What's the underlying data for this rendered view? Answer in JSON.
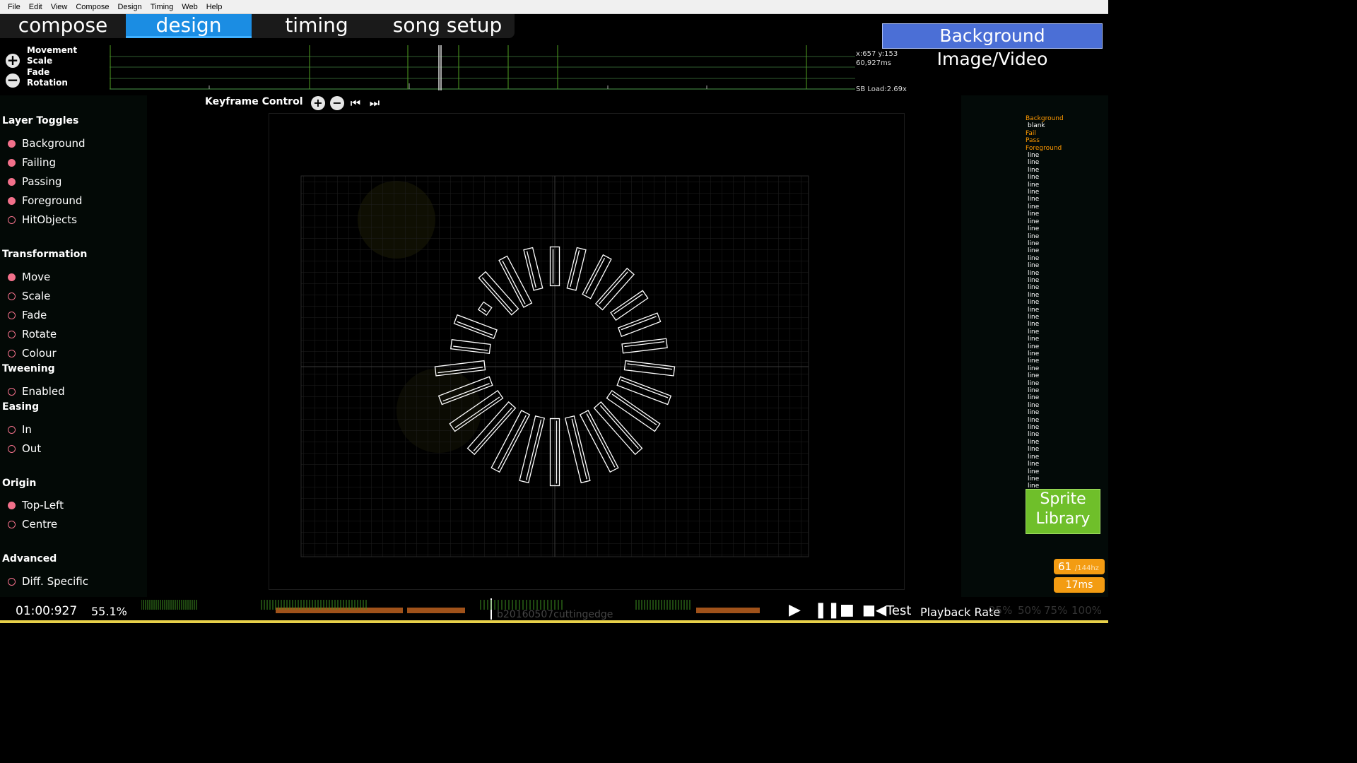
{
  "menubar": {
    "items": [
      "File",
      "Edit",
      "View",
      "Compose",
      "Design",
      "Timing",
      "Web",
      "Help"
    ]
  },
  "mode_tabs": [
    {
      "label": "compose",
      "active": false
    },
    {
      "label": "design",
      "active": true
    },
    {
      "label": "timing",
      "active": false
    },
    {
      "label": "song setup",
      "active": false
    }
  ],
  "background_button": "Background Image/Video",
  "timeline": {
    "labels": [
      "Movement",
      "Scale",
      "Fade",
      "Rotation"
    ],
    "coords": "x:657 y:153",
    "time_ms": "60,927ms",
    "sb_load": "SB Load:2.69x"
  },
  "keyframe_control": {
    "title": "Keyframe Control"
  },
  "sidebar": {
    "layer_toggles": {
      "title": "Layer Toggles",
      "items": [
        {
          "label": "Background",
          "on": true
        },
        {
          "label": "Failing",
          "on": true
        },
        {
          "label": "Passing",
          "on": true
        },
        {
          "label": "Foreground",
          "on": true
        },
        {
          "label": "HitObjects",
          "on": false
        }
      ]
    },
    "transformation": {
      "title": "Transformation",
      "items": [
        {
          "label": "Move",
          "on": true
        },
        {
          "label": "Scale",
          "on": false
        },
        {
          "label": "Fade",
          "on": false
        },
        {
          "label": "Rotate",
          "on": false
        },
        {
          "label": "Colour",
          "on": false
        }
      ]
    },
    "tweening": {
      "title": "Tweening",
      "items": [
        {
          "label": "Enabled",
          "on": false
        }
      ]
    },
    "easing": {
      "title": "Easing",
      "items": [
        {
          "label": "In",
          "on": false
        },
        {
          "label": "Out",
          "on": false
        }
      ]
    },
    "origin": {
      "title": "Origin",
      "items": [
        {
          "label": "Top-Left",
          "on": true
        },
        {
          "label": "Centre",
          "on": false
        }
      ]
    },
    "advanced": {
      "title": "Advanced",
      "items": [
        {
          "label": "Diff. Specific",
          "on": false
        }
      ]
    }
  },
  "layer_list": {
    "groups": [
      {
        "name": "Background",
        "items": [
          "blank"
        ]
      },
      {
        "name": "Fail",
        "items": []
      },
      {
        "name": "Pass",
        "items": []
      },
      {
        "name": "Foreground",
        "items": [
          "line",
          "line",
          "line",
          "line",
          "line",
          "line",
          "line",
          "line",
          "line",
          "line",
          "line",
          "line",
          "line",
          "line",
          "line",
          "line",
          "line",
          "line",
          "line",
          "line",
          "line",
          "line",
          "line",
          "line",
          "line",
          "line",
          "line",
          "line",
          "line",
          "line",
          "line",
          "line",
          "line",
          "line",
          "line",
          "line",
          "line",
          "line",
          "line",
          "line",
          "line",
          "line",
          "line",
          "line",
          "line",
          "line"
        ]
      }
    ]
  },
  "sprite_library": {
    "line1": "Sprite",
    "line2": "Library"
  },
  "perf": {
    "fps": "61",
    "hz": "/144hz",
    "ms": "17ms"
  },
  "bottom": {
    "time": "01:00:927",
    "percent": "55.1%",
    "background_name": "b20160507cuttingedge",
    "test_label": "Test",
    "playback_rate_label": "Playback Rate",
    "rates": [
      "25%",
      "50%",
      "75%",
      "100%"
    ]
  },
  "colors": {
    "accent": "#1b8de3",
    "toggle": "#f2708a",
    "sprite_library": "#6fbf2a",
    "perf": "#f39c12",
    "layer_group": "#ff9900"
  }
}
